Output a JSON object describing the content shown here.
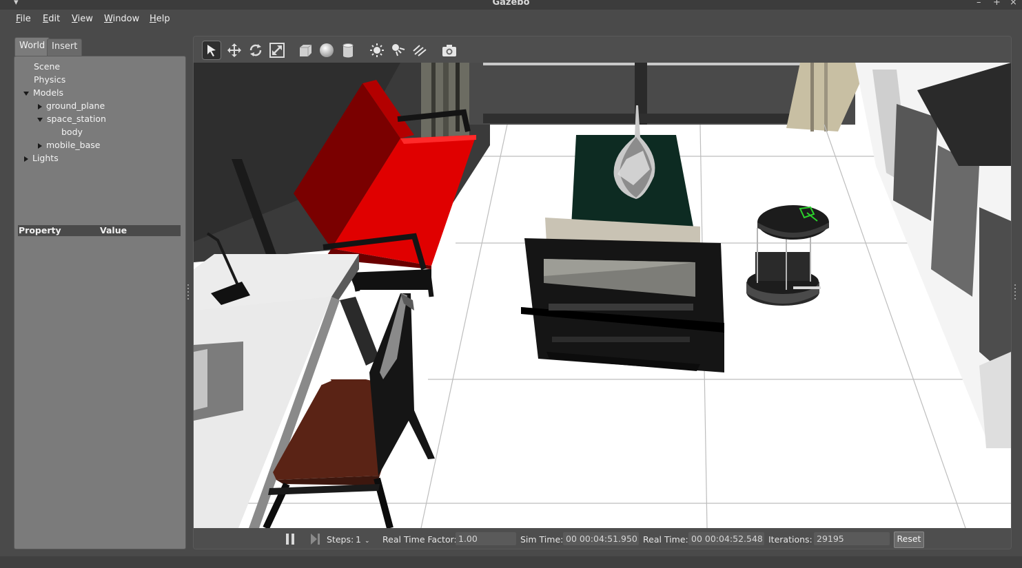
{
  "window": {
    "title": "Gazebo",
    "controls": [
      "–",
      "+",
      "×"
    ]
  },
  "menu": [
    {
      "label": "File",
      "mnemonic": "F",
      "rest": "ile"
    },
    {
      "label": "Edit",
      "mnemonic": "E",
      "rest": "dit"
    },
    {
      "label": "View",
      "mnemonic": "V",
      "rest": "iew"
    },
    {
      "label": "Window",
      "mnemonic": "W",
      "rest": "indow"
    },
    {
      "label": "Help",
      "mnemonic": "H",
      "rest": "elp"
    }
  ],
  "left_panel": {
    "tabs": [
      {
        "label": "World",
        "active": true
      },
      {
        "label": "Insert",
        "active": false
      }
    ],
    "tree": {
      "scene": "Scene",
      "physics": "Physics",
      "models": "Models",
      "ground_plane": "ground_plane",
      "space_station": "space_station",
      "body": "body",
      "mobile_base": "mobile_base",
      "lights": "Lights"
    },
    "property_header": {
      "property": "Property",
      "value": "Value"
    }
  },
  "toolbar": {
    "icons": [
      "select-arrow-icon",
      "translate-icon",
      "rotate-icon",
      "scale-icon",
      "box-shape-icon",
      "sphere-shape-icon",
      "cylinder-shape-icon",
      "point-light-icon",
      "spot-light-icon",
      "directional-light-icon",
      "screenshot-camera-icon"
    ]
  },
  "bottom_bar": {
    "steps_label": "Steps:",
    "steps_value": "1",
    "rtf_label": "Real Time Factor:",
    "rtf_value": "1.00",
    "sim_time_label": "Sim Time:",
    "sim_time_value": "00 00:04:51.950",
    "real_time_label": "Real Time:",
    "real_time_value": "00 00:04:52.548",
    "iterations_label": "Iterations:",
    "iterations_value": "29195",
    "reset_label": "Reset"
  },
  "colors": {
    "sofa_red": "#e00000",
    "robot_green": "#2bd12b",
    "floor": "#ffffff",
    "panel": "#7b7b7b"
  }
}
